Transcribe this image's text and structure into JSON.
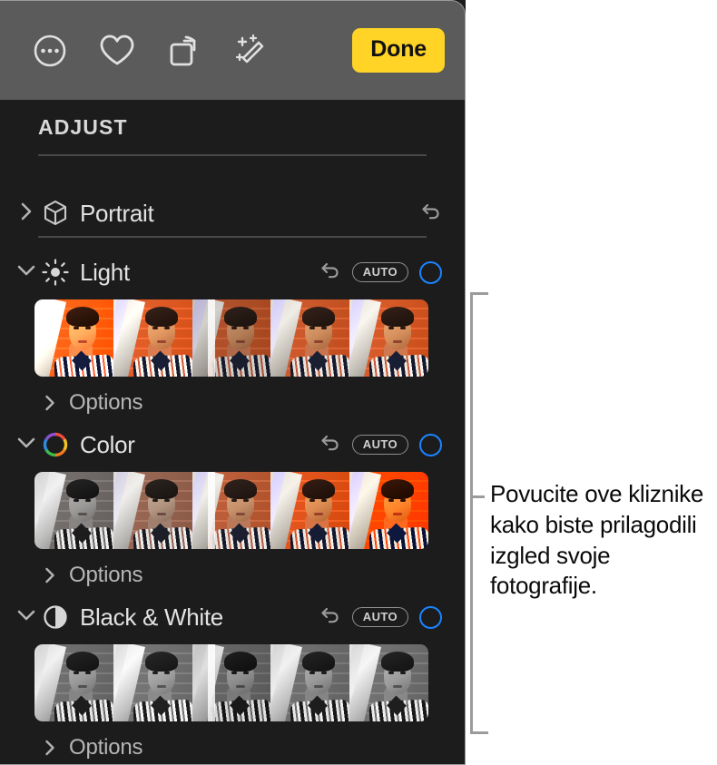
{
  "toolbar": {
    "buttons": [
      {
        "name": "more-options-icon",
        "label": "More options"
      },
      {
        "name": "favorite-heart-icon",
        "label": "Favorite"
      },
      {
        "name": "rotate-icon",
        "label": "Rotate"
      },
      {
        "name": "auto-enhance-icon",
        "label": "Auto enhance"
      }
    ],
    "done_label": "Done",
    "done_color": "#FFD426",
    "background_color": "#5b5b5b"
  },
  "panel": {
    "title": "ADJUST",
    "background_color": "#1c1c1c",
    "accent_color": "#1a84ff"
  },
  "sections": [
    {
      "key": "portrait",
      "label": "Portrait",
      "icon": "cube-icon",
      "expanded": false,
      "disclosure": "chevron-right-icon",
      "has_undo": true,
      "has_auto": false,
      "has_toggle": false,
      "has_strip": false,
      "options_label": null
    },
    {
      "key": "light",
      "label": "Light",
      "icon": "sun-icon",
      "expanded": true,
      "disclosure": "chevron-down-icon",
      "has_undo": true,
      "has_auto": true,
      "auto_label": "AUTO",
      "has_toggle": true,
      "has_strip": true,
      "strip_style": "light",
      "slider_position_percent": 44,
      "options_label": "Options"
    },
    {
      "key": "color",
      "label": "Color",
      "icon": "color-wheel-icon",
      "expanded": true,
      "disclosure": "chevron-down-icon",
      "has_undo": true,
      "has_auto": true,
      "auto_label": "AUTO",
      "has_toggle": true,
      "has_strip": true,
      "strip_style": "color",
      "slider_position_percent": 44,
      "options_label": "Options"
    },
    {
      "key": "black-and-white",
      "label": "Black & White",
      "icon": "contrast-circle-icon",
      "expanded": true,
      "disclosure": "chevron-down-icon",
      "has_undo": true,
      "has_auto": true,
      "auto_label": "AUTO",
      "has_toggle": true,
      "has_strip": true,
      "strip_style": "bw",
      "slider_position_percent": 44,
      "options_label": "Options"
    }
  ],
  "callout": {
    "text": "Povucite ove kliznike kako biste prilagodili izgled svoje fotografije.",
    "line_color": "#9b9b9b"
  }
}
